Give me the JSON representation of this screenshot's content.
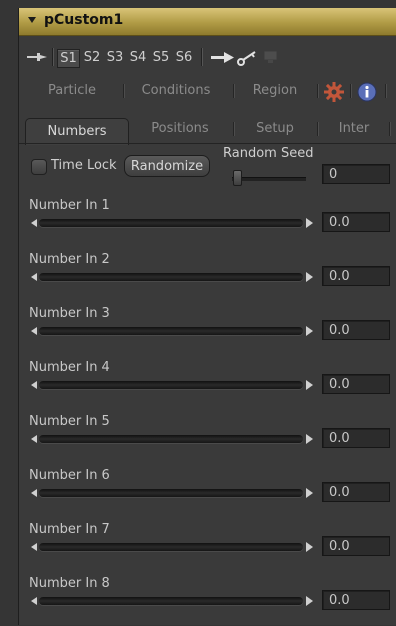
{
  "window": {
    "title": "pCustom1"
  },
  "toolbar": {
    "set_tabs": [
      "S1",
      "S2",
      "S3",
      "S4",
      "S5",
      "S6"
    ],
    "active_set": "S1",
    "icons": [
      "pin-icon",
      "arrow-icon",
      "key-icon",
      "monitor-icon"
    ]
  },
  "tabs_row1": {
    "items": [
      "Particle",
      "Conditions",
      "Region"
    ],
    "icons": [
      "gear-icon",
      "info-icon"
    ]
  },
  "tabs_row2": {
    "items": [
      "Numbers",
      "Positions",
      "Setup",
      "Inter"
    ],
    "active": "Numbers"
  },
  "controls": {
    "time_lock_label": "Time Lock",
    "time_lock_checked": false,
    "randomize_label": "Randomize",
    "random_seed_label": "Random Seed",
    "random_seed_value": "0"
  },
  "sliders": [
    {
      "label": "Number In 1",
      "value": "0.0"
    },
    {
      "label": "Number In 2",
      "value": "0.0"
    },
    {
      "label": "Number In 3",
      "value": "0.0"
    },
    {
      "label": "Number In 4",
      "value": "0.0"
    },
    {
      "label": "Number In 5",
      "value": "0.0"
    },
    {
      "label": "Number In 6",
      "value": "0.0"
    },
    {
      "label": "Number In 7",
      "value": "0.0"
    },
    {
      "label": "Number In 8",
      "value": "0.0"
    }
  ],
  "colors": {
    "title_bar": "#c2ad5a",
    "panel_bg": "#3a3a3a",
    "gear_icon": "#c2563a",
    "info_icon": "#5a6fb8"
  }
}
